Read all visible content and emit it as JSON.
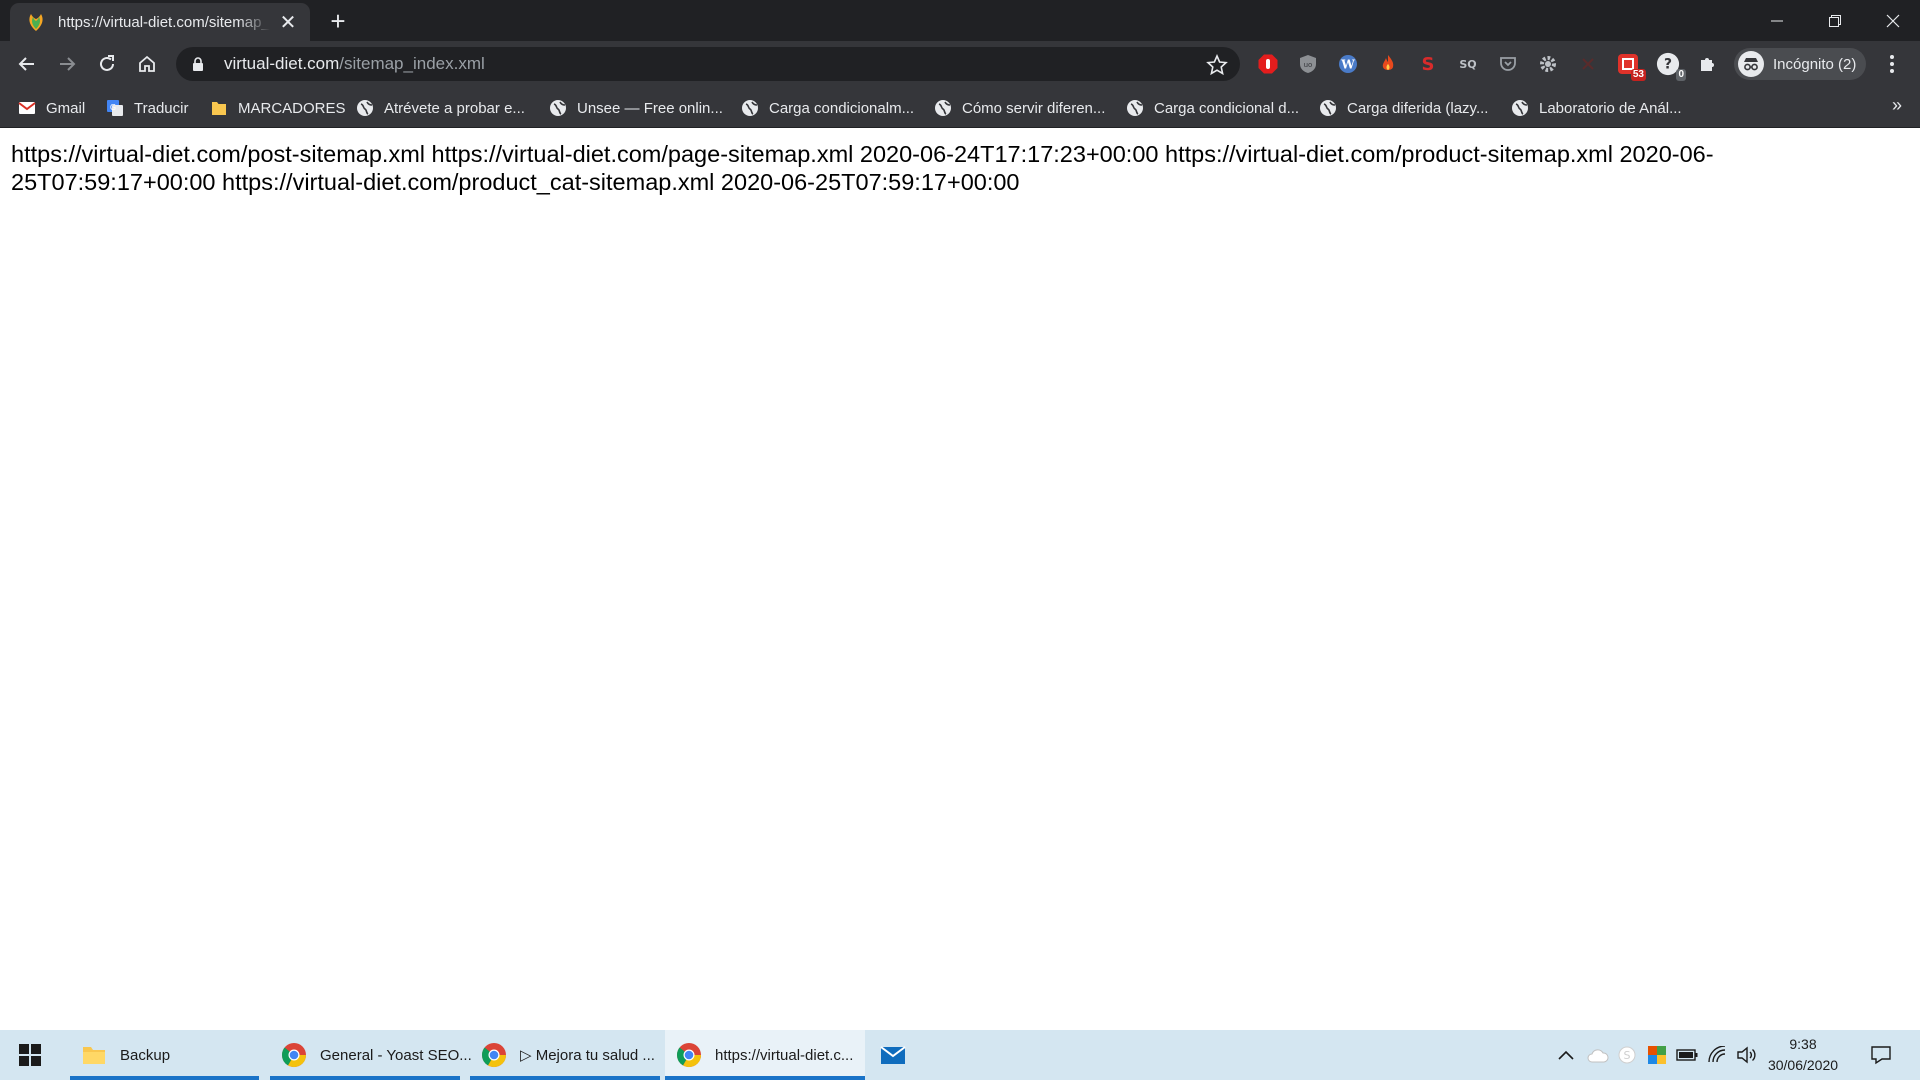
{
  "browser": {
    "tab": {
      "title": "https://virtual-diet.com/sitemap_index.xml"
    },
    "address": {
      "host": "virtual-diet.com",
      "path": "/sitemap_index.xml"
    },
    "profile_label": "Incógnito (2)",
    "extension_badges": {
      "red": "53",
      "grey": "0"
    },
    "bookmarks": [
      {
        "label": "Gmail",
        "icon": "gmail-icon"
      },
      {
        "label": "Traducir",
        "icon": "translate-icon"
      },
      {
        "label": "MARCADORES",
        "icon": "folder-icon"
      },
      {
        "label": "Atrévete a probar e...",
        "icon": "globe-icon"
      },
      {
        "label": "Unsee — Free onlin...",
        "icon": "globe-icon"
      },
      {
        "label": "Carga condicionalm...",
        "icon": "globe-icon"
      },
      {
        "label": "Cómo servir diferen...",
        "icon": "globe-icon"
      },
      {
        "label": "Carga condicional d...",
        "icon": "globe-icon"
      },
      {
        "label": "Carga diferida (lazy...",
        "icon": "globe-icon"
      },
      {
        "label": "Laboratorio de Anál...",
        "icon": "globe-icon"
      }
    ],
    "bookmarks_more": "»"
  },
  "page": {
    "text": "https://virtual-diet.com/post-sitemap.xml https://virtual-diet.com/page-sitemap.xml 2020-06-24T17:17:23+00:00 https://virtual-diet.com/product-sitemap.xml 2020-06-25T07:59:17+00:00 https://virtual-diet.com/product_cat-sitemap.xml 2020-06-25T07:59:17+00:00"
  },
  "taskbar": {
    "tasks": [
      {
        "label": "Backup",
        "icon": "folder-icon"
      },
      {
        "label": "General - Yoast SEO...",
        "icon": "chrome-icon"
      },
      {
        "label": "▷ Mejora tu salud ...",
        "icon": "chrome-icon"
      },
      {
        "label": "https://virtual-diet.c...",
        "icon": "chrome-icon"
      }
    ],
    "clock": {
      "time": "9:38",
      "date": "30/06/2020"
    }
  },
  "colors": {
    "chrome_dark": "#202124",
    "chrome_toolbar": "#35363a",
    "taskbar": "#d4e6f1",
    "taskbar_accent": "#1a73c8"
  }
}
